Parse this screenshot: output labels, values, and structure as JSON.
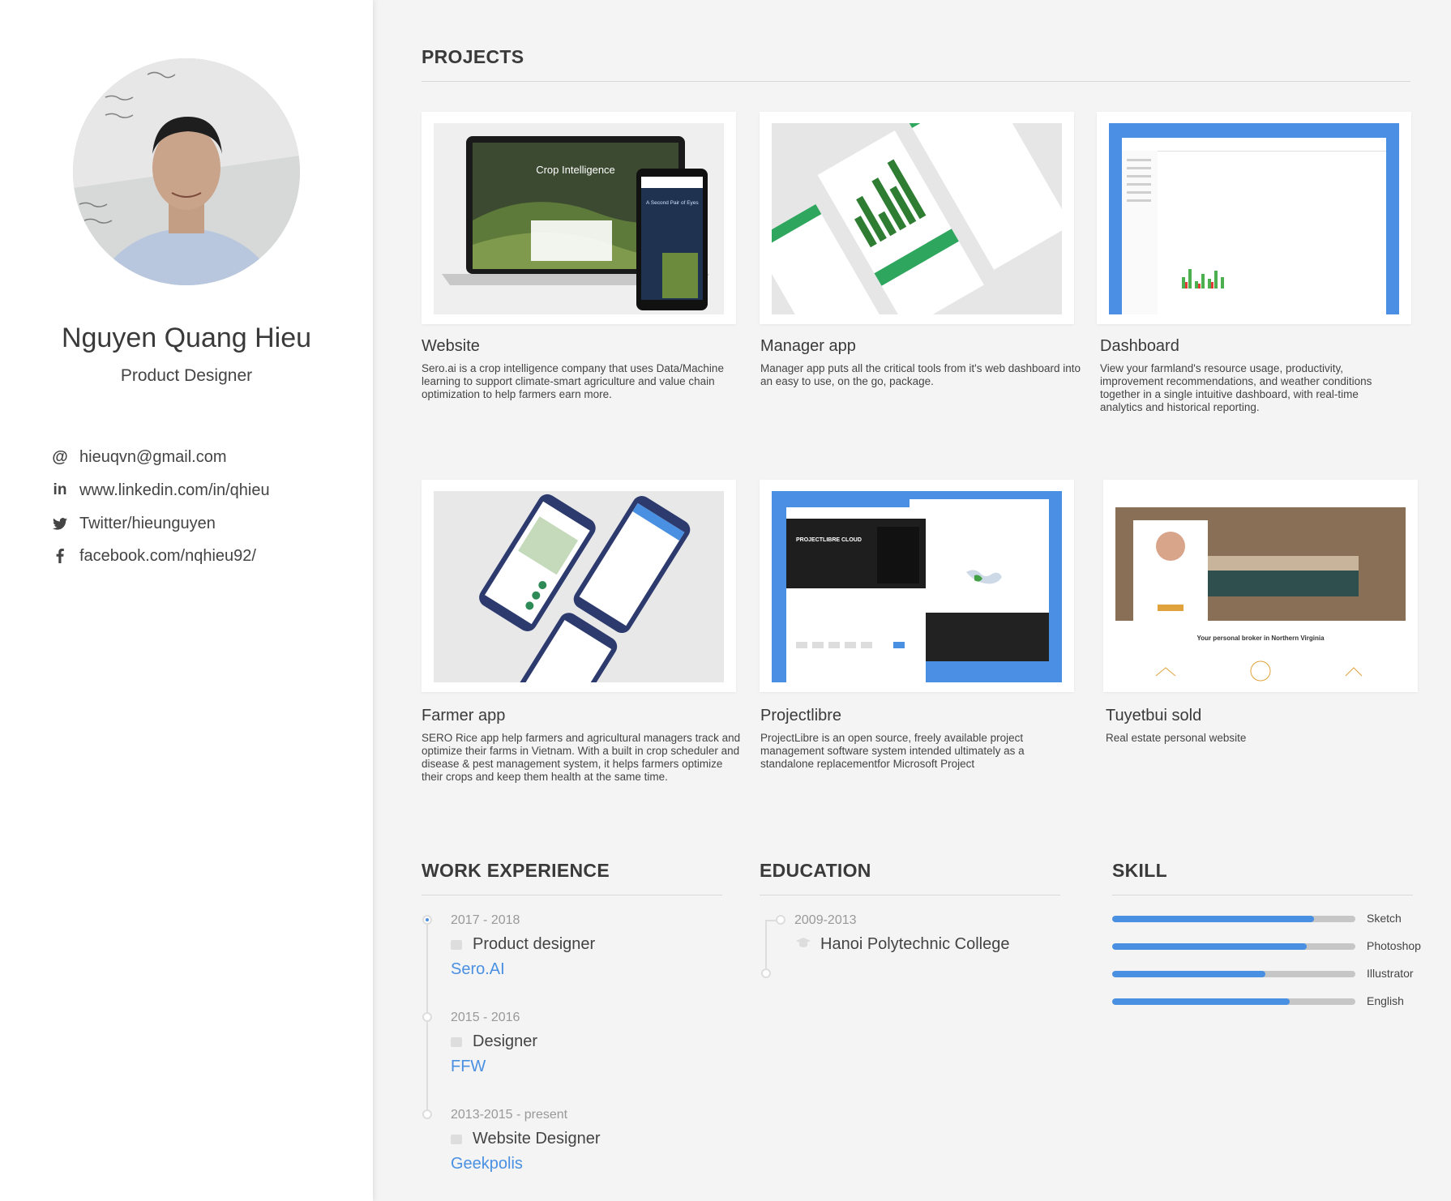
{
  "profile": {
    "name": "Nguyen Quang Hieu",
    "role": "Product Designer",
    "contacts": [
      {
        "icon": "at-icon",
        "text": "hieuqvn@gmail.com"
      },
      {
        "icon": "linkedin-icon",
        "text": "www.linkedin.com/in/qhieu"
      },
      {
        "icon": "twitter-icon",
        "text": "Twitter/hieunguyen"
      },
      {
        "icon": "facebook-icon",
        "text": "facebook.com/nqhieu92/"
      }
    ]
  },
  "projects": {
    "title": "PROJECTS",
    "items": [
      {
        "title": "Website",
        "desc": "Sero.ai is a crop intelligence company that uses Data/Machine learning to support climate-smart agriculture and value chain optimization to help farmers earn more.",
        "thumb_heading": "Crop Intelligence",
        "thumb_sub": "A Second Pair of Eyes"
      },
      {
        "title": "Manager app",
        "desc": "Manager app puts all the critical tools from it's web dashboard into an easy to use, on the go, package."
      },
      {
        "title": "Dashboard",
        "desc": "View your farmland's resource usage, productivity, improvement recommendations, and weather conditions together in a single intuitive dashboard, with real-time analytics and historical reporting."
      },
      {
        "title": "Farmer app",
        "desc": "SERO Rice app help farmers and agricultural managers track and optimize their farms in Vietnam. With a built in crop scheduler and disease & pest management system, it helps farmers optimize their crops and keep them health at the same time."
      },
      {
        "title": "Projectlibre",
        "desc": "ProjectLibre is an open source, freely available project management software system intended ultimately as a standalone replacementfor Microsoft Project",
        "thumb_heading": "PROJECTLIBRE CLOUD"
      },
      {
        "title": "Tuyetbui sold",
        "desc": "Real estate personal website",
        "thumb_heading": "Your personal broker in Northern Virginia"
      }
    ]
  },
  "work": {
    "title": "WORK EXPERIENCE",
    "items": [
      {
        "date": "2017 - 2018",
        "role": "Product designer",
        "company": "Sero.AI"
      },
      {
        "date": "2015 - 2016",
        "role": "Designer",
        "company": "FFW"
      },
      {
        "date": "2013-2015 - present",
        "role": "Website Designer",
        "company": "Geekpolis"
      }
    ]
  },
  "education": {
    "title": "EDUCATION",
    "items": [
      {
        "date": "2009-2013",
        "school": "Hanoi Polytechnic College"
      }
    ]
  },
  "skills": {
    "title": "SKILL",
    "items": [
      {
        "name": "Sketch",
        "level": 0.83
      },
      {
        "name": "Photoshop",
        "level": 0.8
      },
      {
        "name": "Illustrator",
        "level": 0.63
      },
      {
        "name": "English",
        "level": 0.73
      }
    ]
  },
  "colors": {
    "accent": "#4a90e2",
    "background": "#f4f4f4",
    "sidebar": "#ffffff"
  }
}
